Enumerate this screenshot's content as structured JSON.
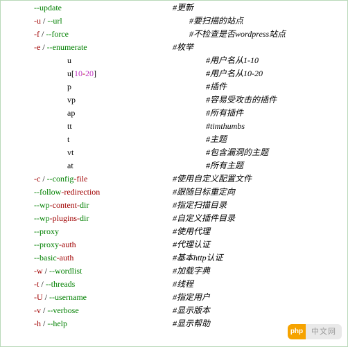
{
  "rows": [
    {
      "indent": 1,
      "html": "<span class='green'>--update</span>",
      "desc": "#更新",
      "descLeft": 248
    },
    {
      "indent": 1,
      "html": "<span class='red'>-u</span> / <span class='green'>--url</span>",
      "desc": "#要扫描的站点",
      "descLeft": 272
    },
    {
      "indent": 1,
      "html": "<span class='red'>-f</span> / <span class='green'>--force</span>",
      "desc": "#不检查是否wordpress站点",
      "descLeft": 272
    },
    {
      "indent": 1,
      "html": "<span class='red'>-e</span> / <span class='green'>--enumerate</span>",
      "desc": "#枚举",
      "descLeft": 248
    },
    {
      "indent": 2,
      "html": "u",
      "desc": "#用户名从1-10",
      "descLeft": 296
    },
    {
      "indent": 2,
      "html": "u[<span class='magenta'>10</span><span class='red'>-</span><span class='magenta'>20</span>]",
      "desc": "#用户名从10-20",
      "descLeft": 296
    },
    {
      "indent": 2,
      "html": "p",
      "desc": "#插件",
      "descLeft": 296
    },
    {
      "indent": 2,
      "html": "vp",
      "desc": "#容易受攻击的插件",
      "descLeft": 296
    },
    {
      "indent": 2,
      "html": "ap",
      "desc": "#所有插件",
      "descLeft": 296
    },
    {
      "indent": 2,
      "html": "tt",
      "desc": "#timthumbs",
      "descLeft": 296
    },
    {
      "indent": 2,
      "html": "t",
      "desc": "#主题",
      "descLeft": 296
    },
    {
      "indent": 2,
      "html": "vt",
      "desc": "#包含漏洞的主题",
      "descLeft": 296
    },
    {
      "indent": 2,
      "html": "at",
      "desc": "#所有主题",
      "descLeft": 296
    },
    {
      "indent": 1,
      "html": "<span class='red'>-c</span> / <span class='green'>--config</span><span class='red'>-file</span>",
      "desc": "#使用自定义配置文件",
      "descLeft": 248
    },
    {
      "indent": 1,
      "html": "<span class='green'>--follow</span><span class='red'>-redirection</span>",
      "desc": "#跟随目标重定向",
      "descLeft": 248
    },
    {
      "indent": 1,
      "html": "<span class='green'>--wp</span><span class='red'>-content-</span><span class='green'>dir</span>",
      "desc": "#指定扫描目录",
      "descLeft": 248
    },
    {
      "indent": 1,
      "html": "<span class='green'>--wp</span><span class='red'>-plugins-</span><span class='green'>dir</span>",
      "desc": "#自定义插件目录",
      "descLeft": 248
    },
    {
      "indent": 1,
      "html": "<span class='green'>--proxy</span>",
      "desc": "#使用代理",
      "descLeft": 248
    },
    {
      "indent": 1,
      "html": "<span class='green'>--proxy</span><span class='red'>-auth</span>",
      "desc": "#代理认证",
      "descLeft": 248
    },
    {
      "indent": 1,
      "html": "<span class='green'>--basic</span><span class='red'>-auth</span>",
      "desc": "#基本http认证",
      "descLeft": 248
    },
    {
      "indent": 1,
      "html": "<span class='red'>-w</span> / <span class='green'>--wordlist</span>",
      "desc": "#加载字典",
      "descLeft": 248
    },
    {
      "indent": 1,
      "html": "<span class='red'>-t</span> / <span class='green'>--threads</span>",
      "desc": "#线程",
      "descLeft": 248
    },
    {
      "indent": 1,
      "html": "<span class='red'>-U</span> / <span class='green'>--username</span>",
      "desc": "#指定用户",
      "descLeft": 248
    },
    {
      "indent": 1,
      "html": "<span class='red'>-v</span> / <span class='green'>--verbose</span>",
      "desc": "#显示版本",
      "descLeft": 248
    },
    {
      "indent": 1,
      "html": "<span class='red'>-h</span> / <span class='green'>--help</span>",
      "desc": "#显示帮助",
      "descLeft": 248
    }
  ],
  "watermark": {
    "logo": "php",
    "text": "中文网"
  }
}
